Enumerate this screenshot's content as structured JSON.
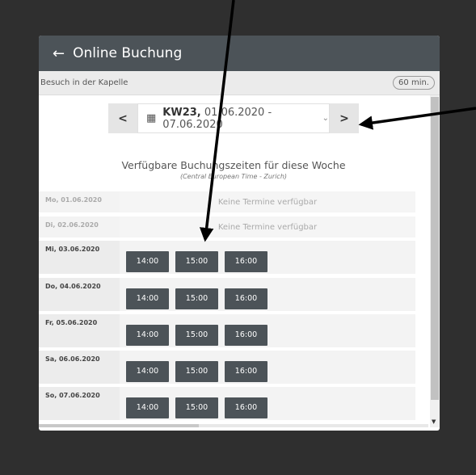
{
  "header": {
    "title": "Online Buchung",
    "back_icon": "arrow-left-icon"
  },
  "subbar": {
    "label": "Besuch in der Kapelle",
    "duration": "60 min."
  },
  "week": {
    "prefix": "KW23,",
    "range": "01.06.2020 - 07.06.2020",
    "prev": "<",
    "next": ">"
  },
  "availability": {
    "title": "Verfügbare Buchungszeiten für diese Woche",
    "timezone": "(Central European Time - Zurich)"
  },
  "days": [
    {
      "date": "Mo, 01.06.2020",
      "empty": "Keine Termine verfügbar"
    },
    {
      "date": "Di, 02.06.2020",
      "empty": "Keine Termine verfügbar"
    },
    {
      "date": "Mi, 03.06.2020",
      "slots": [
        "14:00",
        "15:00",
        "16:00"
      ]
    },
    {
      "date": "Do, 04.06.2020",
      "slots": [
        "14:00",
        "15:00",
        "16:00"
      ]
    },
    {
      "date": "Fr, 05.06.2020",
      "slots": [
        "14:00",
        "15:00",
        "16:00"
      ]
    },
    {
      "date": "Sa, 06.06.2020",
      "slots": [
        "14:00",
        "15:00",
        "16:00"
      ]
    },
    {
      "date": "So, 07.06.2020",
      "slots": [
        "14:00",
        "15:00",
        "16:00"
      ]
    }
  ],
  "colors": {
    "header": "#4c5358",
    "slot": "#4c5358",
    "background": "#2f2f2f"
  }
}
